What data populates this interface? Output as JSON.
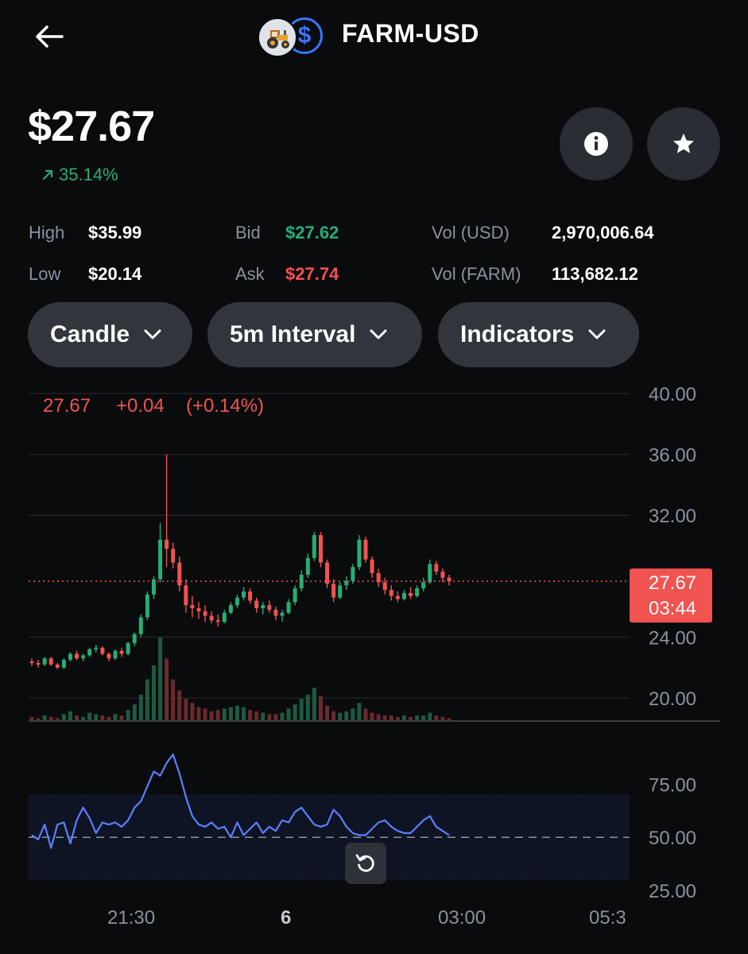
{
  "header": {
    "pair": "FARM-USD",
    "back_icon": "arrow-left-icon",
    "farm_icon": "tractor-icon",
    "usd_symbol": "$"
  },
  "price": {
    "value": "$27.67",
    "change": "35.14%",
    "change_icon": "arrow-up-right-icon"
  },
  "buttons": {
    "info_icon": "info-icon",
    "star_icon": "star-icon"
  },
  "stats": {
    "high_label": "High",
    "high_value": "$35.99",
    "low_label": "Low",
    "low_value": "$20.14",
    "bid_label": "Bid",
    "bid_value": "$27.62",
    "ask_label": "Ask",
    "ask_value": "$27.74",
    "vol_usd_label": "Vol (USD)",
    "vol_usd_value": "2,970,006.64",
    "vol_farm_label": "Vol (FARM)",
    "vol_farm_value": "113,682.12"
  },
  "controls": [
    {
      "label": "Candle"
    },
    {
      "label": "5m Interval"
    },
    {
      "label": "Indicators"
    }
  ],
  "legend": {
    "last": "27.67",
    "delta": "+0.04",
    "pct": "(+0.14%)"
  },
  "current_price_tag": {
    "price": "27.67",
    "countdown": "03:44"
  },
  "colors": {
    "up": "#27ad75",
    "down": "#f05350",
    "rsi": "#5b7fff",
    "bg": "#0a0b0d"
  },
  "chart_data": {
    "type": "candlestick",
    "y_ticks": [
      "40.00",
      "36.00",
      "32.00",
      "24.00",
      "20.00"
    ],
    "ylim": [
      20,
      40
    ],
    "x_ticks": [
      "21:30",
      "6",
      "03:00",
      "05:3"
    ],
    "candles": [
      [
        22.4,
        22.6,
        22.1,
        22.3
      ],
      [
        22.3,
        22.5,
        22.0,
        22.2
      ],
      [
        22.2,
        22.7,
        22.1,
        22.6
      ],
      [
        22.6,
        22.7,
        22.1,
        22.2
      ],
      [
        22.2,
        22.3,
        21.9,
        22.0
      ],
      [
        22.0,
        22.6,
        21.9,
        22.5
      ],
      [
        22.5,
        23.0,
        22.4,
        22.9
      ],
      [
        22.9,
        23.1,
        22.5,
        22.6
      ],
      [
        22.6,
        22.9,
        22.4,
        22.8
      ],
      [
        22.8,
        23.3,
        22.7,
        23.2
      ],
      [
        23.2,
        23.5,
        23.0,
        23.3
      ],
      [
        23.3,
        23.4,
        22.8,
        22.9
      ],
      [
        22.9,
        23.0,
        22.4,
        22.6
      ],
      [
        22.6,
        23.2,
        22.5,
        23.1
      ],
      [
        23.1,
        23.3,
        22.7,
        22.9
      ],
      [
        22.9,
        23.7,
        22.8,
        23.6
      ],
      [
        23.6,
        24.3,
        23.4,
        24.2
      ],
      [
        24.2,
        25.5,
        24.0,
        25.3
      ],
      [
        25.3,
        27.0,
        25.1,
        26.8
      ],
      [
        26.8,
        28.0,
        26.5,
        27.8
      ],
      [
        27.8,
        31.5,
        27.6,
        30.4
      ],
      [
        30.4,
        36.0,
        28.6,
        29.8
      ],
      [
        29.8,
        30.2,
        28.5,
        28.9
      ],
      [
        28.9,
        29.3,
        27.0,
        27.4
      ],
      [
        27.4,
        27.8,
        25.6,
        26.1
      ],
      [
        26.1,
        26.7,
        25.3,
        25.9
      ],
      [
        25.9,
        26.3,
        25.2,
        25.7
      ],
      [
        25.7,
        26.1,
        25.0,
        25.4
      ],
      [
        25.4,
        25.7,
        24.9,
        25.1
      ],
      [
        25.1,
        25.5,
        24.7,
        25.0
      ],
      [
        25.0,
        25.8,
        24.9,
        25.6
      ],
      [
        25.6,
        26.3,
        25.5,
        26.1
      ],
      [
        26.1,
        26.8,
        25.9,
        26.6
      ],
      [
        26.6,
        27.3,
        26.4,
        27.0
      ],
      [
        27.0,
        27.2,
        26.2,
        26.4
      ],
      [
        26.4,
        26.6,
        25.6,
        25.9
      ],
      [
        25.9,
        26.3,
        25.5,
        26.1
      ],
      [
        26.1,
        26.4,
        25.6,
        25.8
      ],
      [
        25.8,
        26.0,
        25.1,
        25.4
      ],
      [
        25.4,
        25.8,
        25.0,
        25.6
      ],
      [
        25.6,
        26.5,
        25.5,
        26.3
      ],
      [
        26.3,
        27.4,
        26.1,
        27.2
      ],
      [
        27.2,
        28.4,
        27.0,
        28.1
      ],
      [
        28.1,
        29.5,
        27.9,
        29.2
      ],
      [
        29.2,
        30.9,
        29.0,
        30.7
      ],
      [
        30.7,
        30.9,
        28.6,
        28.9
      ],
      [
        28.9,
        29.1,
        27.2,
        27.5
      ],
      [
        27.5,
        27.8,
        26.3,
        26.6
      ],
      [
        26.6,
        27.6,
        26.5,
        27.4
      ],
      [
        27.4,
        28.0,
        27.1,
        27.7
      ],
      [
        27.7,
        28.8,
        27.5,
        28.6
      ],
      [
        28.6,
        30.7,
        28.4,
        30.4
      ],
      [
        30.4,
        30.6,
        28.9,
        29.1
      ],
      [
        29.1,
        29.3,
        27.9,
        28.2
      ],
      [
        28.2,
        28.5,
        27.3,
        27.6
      ],
      [
        27.6,
        27.9,
        26.8,
        27.1
      ],
      [
        27.1,
        27.4,
        26.4,
        26.7
      ],
      [
        26.7,
        27.0,
        26.3,
        26.5
      ],
      [
        26.5,
        27.1,
        26.4,
        26.9
      ],
      [
        26.9,
        27.3,
        26.5,
        26.7
      ],
      [
        26.7,
        27.4,
        26.6,
        27.2
      ],
      [
        27.2,
        27.9,
        27.0,
        27.6
      ],
      [
        27.6,
        29.1,
        27.5,
        28.8
      ],
      [
        28.8,
        29.0,
        28.1,
        28.3
      ],
      [
        28.3,
        28.5,
        27.6,
        27.9
      ],
      [
        27.9,
        28.1,
        27.4,
        27.67
      ]
    ],
    "volumes": [
      0.3,
      0.2,
      0.4,
      0.3,
      0.2,
      0.5,
      0.7,
      0.4,
      0.3,
      0.6,
      0.5,
      0.4,
      0.3,
      0.5,
      0.4,
      0.8,
      1.2,
      1.9,
      3.0,
      4.0,
      6.0,
      4.5,
      3.0,
      2.2,
      1.6,
      1.3,
      1.0,
      0.9,
      0.7,
      0.8,
      0.9,
      1.0,
      1.1,
      1.0,
      0.8,
      0.7,
      0.6,
      0.5,
      0.5,
      0.6,
      0.9,
      1.2,
      1.6,
      1.9,
      2.4,
      1.8,
      1.1,
      0.7,
      0.6,
      0.7,
      0.9,
      1.3,
      0.9,
      0.6,
      0.5,
      0.4,
      0.4,
      0.3,
      0.4,
      0.3,
      0.4,
      0.4,
      0.6,
      0.4,
      0.3,
      0.2
    ],
    "rsi": {
      "y_ticks": [
        "75.00",
        "50.00",
        "25.00"
      ],
      "ylim": [
        25,
        95
      ],
      "band": [
        30,
        70
      ],
      "midline": 50,
      "values": [
        51,
        49,
        56,
        45,
        56,
        57,
        47,
        58,
        64,
        59,
        52,
        57,
        56,
        57,
        55,
        58,
        64,
        67,
        74,
        81,
        79,
        85,
        89,
        80,
        69,
        60,
        56,
        55,
        57,
        54,
        55,
        50,
        57,
        51,
        54,
        57,
        52,
        55,
        53,
        58,
        57,
        62,
        64,
        60,
        56,
        55,
        56,
        63,
        60,
        55,
        52,
        51,
        51,
        54,
        57,
        58,
        55,
        53,
        52,
        52,
        55,
        58,
        60,
        55,
        53,
        51
      ]
    }
  }
}
